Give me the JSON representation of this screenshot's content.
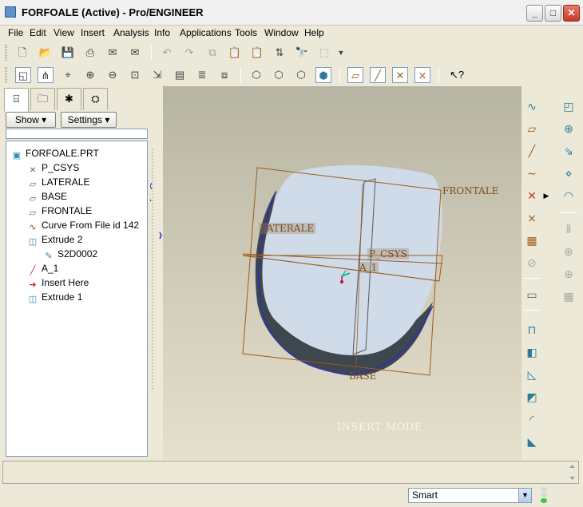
{
  "window": {
    "title": "FORFOALE (Active) - Pro/ENGINEER",
    "minimize": "_",
    "maximize": "□",
    "close": "✕"
  },
  "menu": [
    "File",
    "Edit",
    "View",
    "Insert",
    "Analysis",
    "Info",
    "Applications",
    "Tools",
    "Window",
    "Help"
  ],
  "panel": {
    "show_label": "Show ▾",
    "settings_label": "Settings ▾",
    "tree": [
      {
        "label": "FORFOALE.PRT",
        "icon": "part-icon",
        "glyph": "▣",
        "indent": 0,
        "color": "#2e8fb0"
      },
      {
        "label": "P_CSYS",
        "icon": "csys-icon",
        "glyph": "⨯",
        "indent": 1,
        "color": "#8a4a1a"
      },
      {
        "label": "LATERALE",
        "icon": "datum-plane-icon",
        "glyph": "▱",
        "indent": 1,
        "color": "#8a4a1a"
      },
      {
        "label": "BASE",
        "icon": "datum-plane-icon",
        "glyph": "▱",
        "indent": 1,
        "color": "#8a4a1a"
      },
      {
        "label": "FRONTALE",
        "icon": "datum-plane-icon",
        "glyph": "▱",
        "indent": 1,
        "color": "#8a4a1a"
      },
      {
        "label": "Curve From File id 142",
        "icon": "curve-icon",
        "glyph": "∿",
        "indent": 1,
        "color": "#8a4a1a"
      },
      {
        "label": "Extrude 2",
        "icon": "extrude-icon",
        "glyph": "◫",
        "indent": 1,
        "color": "#2e8fb0"
      },
      {
        "label": "S2D0002",
        "icon": "sketch-icon",
        "glyph": "✎",
        "indent": 2,
        "color": "#2e8fb0"
      },
      {
        "label": "A_1",
        "icon": "axis-icon",
        "glyph": "╱",
        "indent": 1,
        "color": "#c0392b"
      },
      {
        "label": "Insert Here",
        "icon": "insert-arrow-icon",
        "glyph": "➔",
        "indent": 1,
        "color": "#d02020"
      },
      {
        "label": "Extrude 1",
        "icon": "extrude-icon",
        "glyph": "◫",
        "indent": 1,
        "color": "#2e8fb0"
      }
    ]
  },
  "viewport": {
    "labels": {
      "frontale": "FRONTALE",
      "laterale": "LATERALE",
      "csys": "P_CSYS",
      "axis": "A_1",
      "base": "BASE"
    },
    "mode": "INSERT MODE"
  },
  "status": {
    "filter": "Smart"
  },
  "colors": {
    "datum": "#9c5c1c",
    "part_face": "#cfdbe9",
    "part_shadow": "#3e464e",
    "curve": "#2b2bd0"
  }
}
